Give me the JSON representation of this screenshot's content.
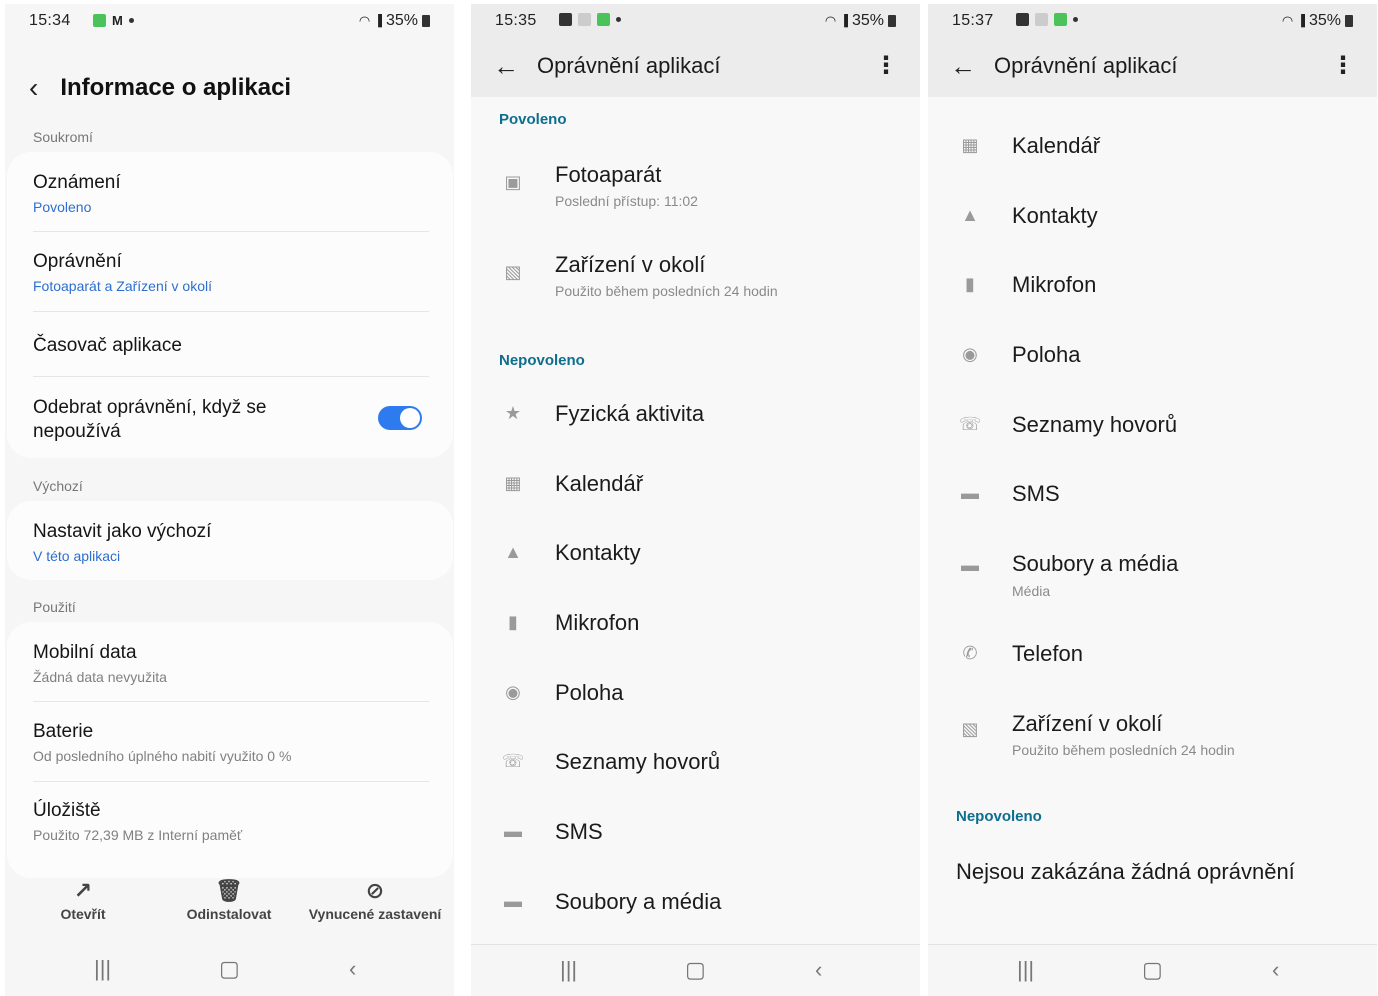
{
  "screen1": {
    "status": {
      "time": "15:34",
      "battery": "35%"
    },
    "title": "Informace o aplikaci",
    "sections": {
      "privacy": "Soukromí",
      "defaults": "Výchozí",
      "usage": "Použití"
    },
    "rows": {
      "notifications": {
        "title": "Oznámení",
        "sub": "Povoleno"
      },
      "permissions": {
        "title": "Oprávnění",
        "sub": "Fotoaparát a Zařízení v okolí"
      },
      "timer": {
        "title": "Časovač aplikace"
      },
      "remove": {
        "title": "Odebrat oprávnění, když se nepoužívá"
      },
      "default": {
        "title": "Nastavit jako výchozí",
        "sub": "V této aplikaci"
      },
      "mobile": {
        "title": "Mobilní data",
        "sub": "Žádná data nevyužita"
      },
      "battery": {
        "title": "Baterie",
        "sub": "Od posledního úplného nabití využito 0 %"
      },
      "storage": {
        "title": "Úložiště",
        "sub": "Použito 72,39 MB z Interní paměť"
      }
    },
    "actions": {
      "open": "Otevřít",
      "uninstall": "Odinstalovat",
      "force_stop": "Vynucené zastavení"
    }
  },
  "screen2": {
    "status": {
      "time": "15:35",
      "battery": "35%"
    },
    "title": "Oprávnění aplikací",
    "allowed_label": "Povoleno",
    "denied_label": "Nepovoleno",
    "allowed": [
      {
        "name": "Fotoaparát",
        "sub": "Poslední přístup: 11:02",
        "icon": "camera-icon"
      },
      {
        "name": "Zařízení v okolí",
        "sub": "Použito během posledních 24 hodin",
        "icon": "nearby-devices-icon"
      }
    ],
    "denied": [
      {
        "name": "Fyzická aktivita",
        "icon": "activity-icon"
      },
      {
        "name": "Kalendář",
        "icon": "calendar-icon"
      },
      {
        "name": "Kontakty",
        "icon": "contacts-icon"
      },
      {
        "name": "Mikrofon",
        "icon": "microphone-icon"
      },
      {
        "name": "Poloha",
        "icon": "location-icon"
      },
      {
        "name": "Seznamy hovorů",
        "icon": "call-log-icon"
      },
      {
        "name": "SMS",
        "icon": "sms-icon"
      },
      {
        "name": "Soubory a média",
        "icon": "folder-icon"
      }
    ]
  },
  "screen3": {
    "status": {
      "time": "15:37",
      "battery": "35%"
    },
    "title": "Oprávnění aplikací",
    "allowed": [
      {
        "name": "Kalendář",
        "icon": "calendar-icon"
      },
      {
        "name": "Kontakty",
        "icon": "contacts-icon"
      },
      {
        "name": "Mikrofon",
        "icon": "microphone-icon"
      },
      {
        "name": "Poloha",
        "icon": "location-icon"
      },
      {
        "name": "Seznamy hovorů",
        "icon": "call-log-icon"
      },
      {
        "name": "SMS",
        "icon": "sms-icon"
      },
      {
        "name": "Soubory a média",
        "sub": "Média",
        "icon": "folder-icon"
      },
      {
        "name": "Telefon",
        "icon": "phone-icon"
      },
      {
        "name": "Zařízení v okolí",
        "sub": "Použito během posledních 24 hodin",
        "icon": "nearby-devices-icon"
      }
    ],
    "denied_label": "Nepovoleno",
    "denied_empty": "Nejsou zakázána žádná oprávnění"
  },
  "colors": {
    "accent_blue": "#2e7bef",
    "section_teal": "#0d6e8e",
    "link_blue": "#2d6ecf"
  }
}
